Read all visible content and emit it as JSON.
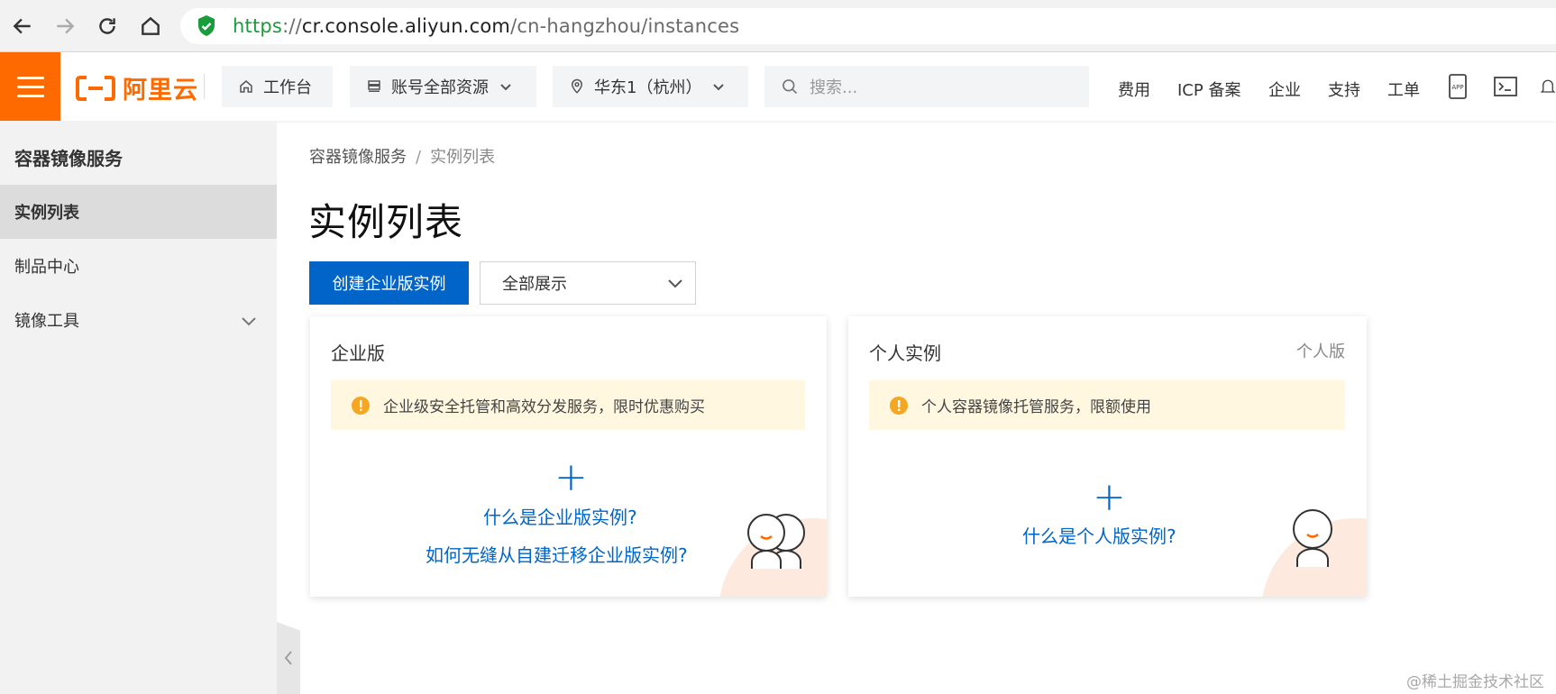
{
  "browser": {
    "url_scheme": "https",
    "url_sep": "://",
    "url_host": "cr.console.aliyun.com",
    "url_path": "/cn-hangzhou/instances"
  },
  "topnav": {
    "logo_text": "阿里云",
    "workbench": "工作台",
    "resources": "账号全部资源",
    "region": "华东1（杭州）",
    "search_placeholder": "搜索...",
    "links": [
      "费用",
      "ICP 备案",
      "企业",
      "支持",
      "工单"
    ],
    "app_badge": "APP"
  },
  "sidebar": {
    "title": "容器镜像服务",
    "items": [
      {
        "label": "实例列表",
        "active": true
      },
      {
        "label": "制品中心",
        "active": false
      },
      {
        "label": "镜像工具",
        "active": false
      }
    ]
  },
  "main": {
    "breadcrumb": [
      "容器镜像服务",
      "实例列表"
    ],
    "breadcrumb_sep": "/",
    "title": "实例列表",
    "create_button": "创建企业版实例",
    "filter_select": "全部展示",
    "cards": [
      {
        "title": "企业版",
        "tag": "",
        "notice": "企业级安全托管和高效分发服务，限时优惠购买",
        "links": [
          "什么是企业版实例?",
          "如何无缝从自建迁移企业版实例?"
        ]
      },
      {
        "title": "个人实例",
        "tag": "个人版",
        "notice": "个人容器镜像托管服务，限额使用",
        "links": [
          "什么是个人版实例?"
        ]
      }
    ]
  },
  "watermark": "@稀土掘金技术社区",
  "colors": {
    "brand_orange": "#ff6a00",
    "primary_blue": "#0064c8",
    "notice_bg": "#fff7e0",
    "warn_yellow": "#f5a623"
  }
}
